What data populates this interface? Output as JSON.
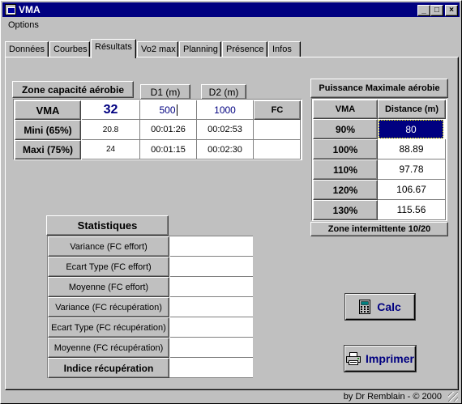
{
  "window": {
    "title": "VMA"
  },
  "menu": {
    "options": "Options"
  },
  "tabs": [
    "Données",
    "Courbes",
    "Résultats",
    "Vo2 max",
    "Planning",
    "Présence",
    "Infos"
  ],
  "zone": {
    "title": "Zone capacité aérobie",
    "d1_header": "D1 (m)",
    "d2_header": "D2 (m)",
    "vma_label": "VMA",
    "vma_value": "32",
    "d1_value": "500",
    "d2_value": "1000",
    "fc_label": "FC",
    "rows": [
      {
        "label": "Mini (65%)",
        "vma": "20.8",
        "d1": "00:01:26",
        "d2": "00:02:53",
        "fc": ""
      },
      {
        "label": "Maxi (75%)",
        "vma": "24",
        "d1": "00:01:15",
        "d2": "00:02:30",
        "fc": ""
      }
    ]
  },
  "pma": {
    "title": "Puissance Maximale aérobie",
    "col_vma": "VMA",
    "col_distance": "Distance (m)",
    "rows": [
      {
        "pct": "90%",
        "distance": "80"
      },
      {
        "pct": "100%",
        "distance": "88.89"
      },
      {
        "pct": "110%",
        "distance": "97.78"
      },
      {
        "pct": "120%",
        "distance": "106.67"
      },
      {
        "pct": "130%",
        "distance": "115.56"
      }
    ],
    "footer": "Zone intermittente 10/20"
  },
  "stats": {
    "title": "Statistiques",
    "rows": [
      {
        "label": "Variance (FC effort)",
        "value": ""
      },
      {
        "label": "Ecart Type (FC effort)",
        "value": ""
      },
      {
        "label": "Moyenne (FC effort)",
        "value": ""
      },
      {
        "label": "Variance (FC récupération)",
        "value": ""
      },
      {
        "label": "Ecart Type (FC récupération)",
        "value": ""
      },
      {
        "label": "Moyenne (FC récupération)",
        "value": ""
      }
    ],
    "indice_label": "Indice récupération",
    "indice_value": ""
  },
  "buttons": {
    "calc": "Calc",
    "print": "Imprimer"
  },
  "status": {
    "credit": "by Dr Remblain - © 2000"
  },
  "icons": {
    "calc": "calculator-icon",
    "print": "printer-icon"
  }
}
